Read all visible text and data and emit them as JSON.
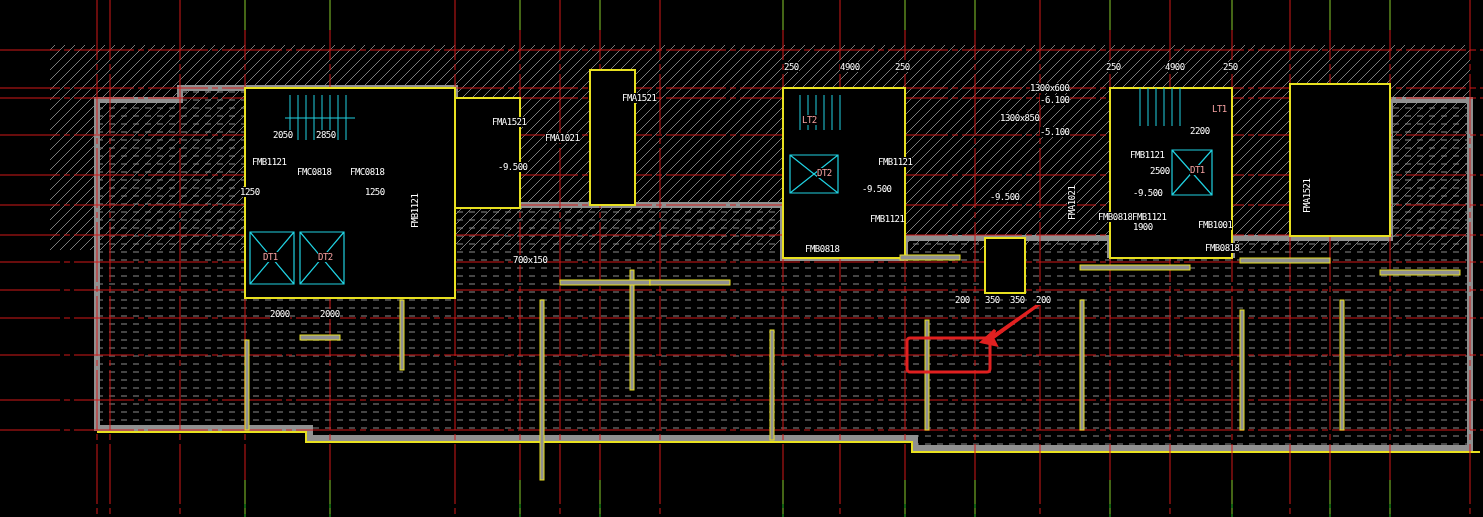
{
  "drawing": {
    "labels": [
      {
        "kind": "door-tag",
        "text": "FMB1121"
      },
      {
        "kind": "door-tag",
        "text": "FMC0818"
      },
      {
        "kind": "door-tag",
        "text": "FMC0818"
      },
      {
        "kind": "door-tag",
        "text": "FMA1521"
      },
      {
        "kind": "door-tag",
        "text": "FMA1021"
      },
      {
        "kind": "door-tag",
        "text": "FMB1121"
      },
      {
        "kind": "door-tag",
        "text": "FMA1521"
      },
      {
        "kind": "door-tag",
        "text": "FMB1121"
      },
      {
        "kind": "door-tag",
        "text": "FMB1121"
      },
      {
        "kind": "door-tag",
        "text": "FMB0818"
      },
      {
        "kind": "door-tag",
        "text": "FMB1121"
      },
      {
        "kind": "door-tag",
        "text": "FMB0818"
      },
      {
        "kind": "door-tag",
        "text": "FMB1121"
      },
      {
        "kind": "door-tag",
        "text": "FMB1001"
      },
      {
        "kind": "door-tag",
        "text": "FMB0818"
      },
      {
        "kind": "door-tag",
        "text": "FMA1021"
      },
      {
        "kind": "door-tag",
        "text": "FMA1521"
      },
      {
        "kind": "elevation",
        "text": "-9.500"
      },
      {
        "kind": "elevation",
        "text": "-9.500"
      },
      {
        "kind": "elevation",
        "text": "-9.500"
      },
      {
        "kind": "elevation",
        "text": "-9.500"
      },
      {
        "kind": "elevation",
        "text": "-6.100"
      },
      {
        "kind": "elevation",
        "text": "-5.100"
      },
      {
        "kind": "equipment",
        "text": "LT2"
      },
      {
        "kind": "equipment",
        "text": "LT1"
      },
      {
        "kind": "equipment",
        "text": "DT2"
      },
      {
        "kind": "equipment",
        "text": "DT1"
      },
      {
        "kind": "equipment",
        "text": "DT1"
      },
      {
        "kind": "equipment",
        "text": "DT2"
      },
      {
        "kind": "dimension",
        "text": "250"
      },
      {
        "kind": "dimension",
        "text": "4900"
      },
      {
        "kind": "dimension",
        "text": "250"
      },
      {
        "kind": "dimension",
        "text": "250"
      },
      {
        "kind": "dimension",
        "text": "4900"
      },
      {
        "kind": "dimension",
        "text": "250"
      },
      {
        "kind": "dimension",
        "text": "1300x600"
      },
      {
        "kind": "dimension",
        "text": "1300x850"
      },
      {
        "kind": "dimension",
        "text": "700x150"
      },
      {
        "kind": "dimension",
        "text": "2050"
      },
      {
        "kind": "dimension",
        "text": "2850"
      },
      {
        "kind": "dimension",
        "text": "1250"
      },
      {
        "kind": "dimension",
        "text": "1250"
      },
      {
        "kind": "dimension",
        "text": "2000"
      },
      {
        "kind": "dimension",
        "text": "2000"
      },
      {
        "kind": "dimension",
        "text": "2500"
      },
      {
        "kind": "dimension",
        "text": "1900"
      },
      {
        "kind": "dimension",
        "text": "2200"
      },
      {
        "kind": "dimension",
        "text": "200"
      },
      {
        "kind": "dimension",
        "text": "350"
      },
      {
        "kind": "dimension",
        "text": "350"
      },
      {
        "kind": "dimension",
        "text": "200"
      }
    ]
  }
}
